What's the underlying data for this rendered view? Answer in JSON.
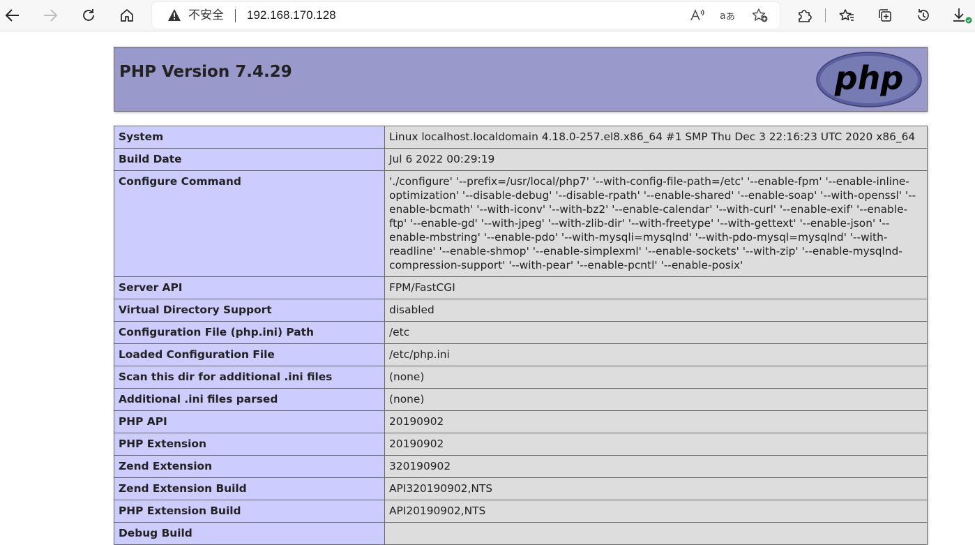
{
  "browser": {
    "security_label": "不安全",
    "url": "192.168.170.128"
  },
  "page": {
    "title": "PHP Version 7.4.29",
    "logo_text": "php"
  },
  "rows": [
    {
      "key": "System",
      "value": "Linux localhost.localdomain 4.18.0-257.el8.x86_64 #1 SMP Thu Dec 3 22:16:23 UTC 2020 x86_64"
    },
    {
      "key": "Build Date",
      "value": "Jul 6 2022 00:29:19"
    },
    {
      "key": "Configure Command",
      "value": "'./configure' '--prefix=/usr/local/php7' '--with-config-file-path=/etc' '--enable-fpm' '--enable-inline-optimization' '--disable-debug' '--disable-rpath' '--enable-shared' '--enable-soap' '--with-openssl' '--enable-bcmath' '--with-iconv' '--with-bz2' '--enable-calendar' '--with-curl' '--enable-exif' '--enable-ftp' '--enable-gd' '--with-jpeg' '--with-zlib-dir' '--with-freetype' '--with-gettext' '--enable-json' '--enable-mbstring' '--enable-pdo' '--with-mysqli=mysqlnd' '--with-pdo-mysql=mysqlnd' '--with-readline' '--enable-shmop' '--enable-simplexml' '--enable-sockets' '--with-zip' '--enable-mysqlnd-compression-support' '--with-pear' '--enable-pcntl' '--enable-posix'"
    },
    {
      "key": "Server API",
      "value": "FPM/FastCGI"
    },
    {
      "key": "Virtual Directory Support",
      "value": "disabled"
    },
    {
      "key": "Configuration File (php.ini) Path",
      "value": "/etc"
    },
    {
      "key": "Loaded Configuration File",
      "value": "/etc/php.ini"
    },
    {
      "key": "Scan this dir for additional .ini files",
      "value": "(none)"
    },
    {
      "key": "Additional .ini files parsed",
      "value": "(none)"
    },
    {
      "key": "PHP API",
      "value": "20190902"
    },
    {
      "key": "PHP Extension",
      "value": "20190902"
    },
    {
      "key": "Zend Extension",
      "value": "320190902"
    },
    {
      "key": "Zend Extension Build",
      "value": "API320190902,NTS"
    },
    {
      "key": "PHP Extension Build",
      "value": "API20190902,NTS"
    },
    {
      "key": "Debug Build",
      "value": ""
    }
  ],
  "colors": {
    "header_bg": "#9999cc",
    "key_bg": "#ccccff",
    "value_bg": "#dddddd",
    "border": "#666666"
  }
}
